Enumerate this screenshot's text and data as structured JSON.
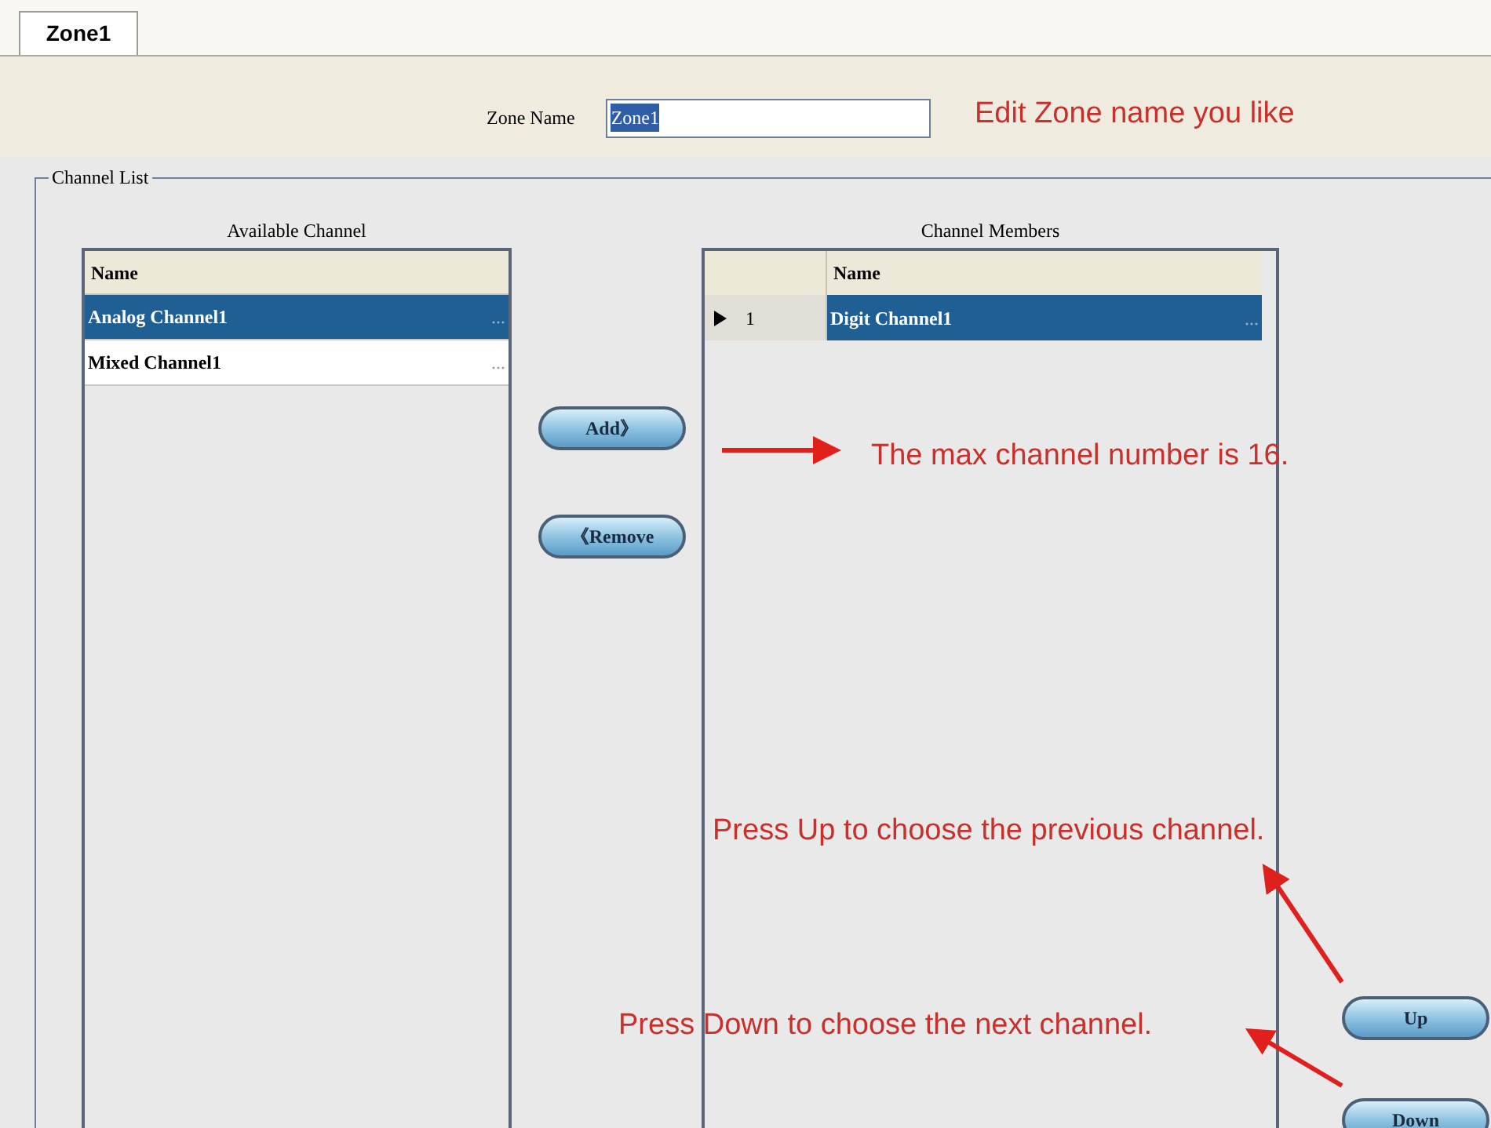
{
  "tabs": [
    {
      "label": "Zone1",
      "selected": true
    }
  ],
  "zone_name": {
    "label": "Zone Name",
    "value": "Zone1"
  },
  "channel_list": {
    "title": "Channel List",
    "available": {
      "title": "Available Channel",
      "column": "Name",
      "rows": [
        {
          "name": "Analog Channel1",
          "more": "...",
          "selected": true
        },
        {
          "name": "Mixed Channel1",
          "more": "...",
          "selected": false
        }
      ]
    },
    "move_buttons": [
      "Add》",
      "《Remove"
    ],
    "members": {
      "title": "Channel Members",
      "column": "Name",
      "rows": [
        {
          "index": "1",
          "name": "Digit Channel1",
          "more": "...",
          "selected": true
        }
      ]
    },
    "order_buttons": [
      "Up",
      "Down"
    ]
  },
  "annotations": [
    {
      "text": "Edit Zone name you like"
    },
    {
      "text": "The max channel number is 16."
    },
    {
      "text": "Press Up to choose the previous channel."
    },
    {
      "text": "Press Down to choose the next channel."
    }
  ]
}
